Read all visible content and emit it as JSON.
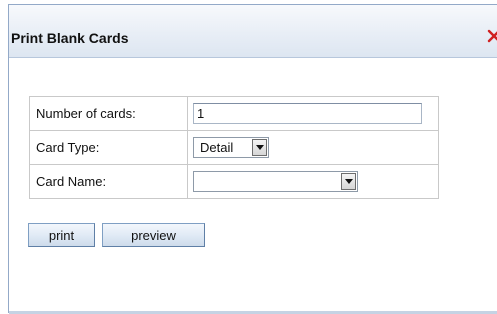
{
  "dialog": {
    "title": "Print Blank Cards",
    "close_icon": "close-x-icon",
    "close_color": "#d02020"
  },
  "form": {
    "number_of_cards": {
      "label": "Number of cards:",
      "value": "1"
    },
    "card_type": {
      "label": "Card Type:",
      "selected": "Detail"
    },
    "card_name": {
      "label": "Card Name:",
      "selected": ""
    }
  },
  "buttons": {
    "print_label": "print",
    "preview_label": "preview"
  },
  "colors": {
    "title_gradient_top": "#f7f9fc",
    "title_gradient_bottom": "#dde6f1",
    "frame_border": "#93a9c8",
    "button_border": "#7f9fc3"
  }
}
